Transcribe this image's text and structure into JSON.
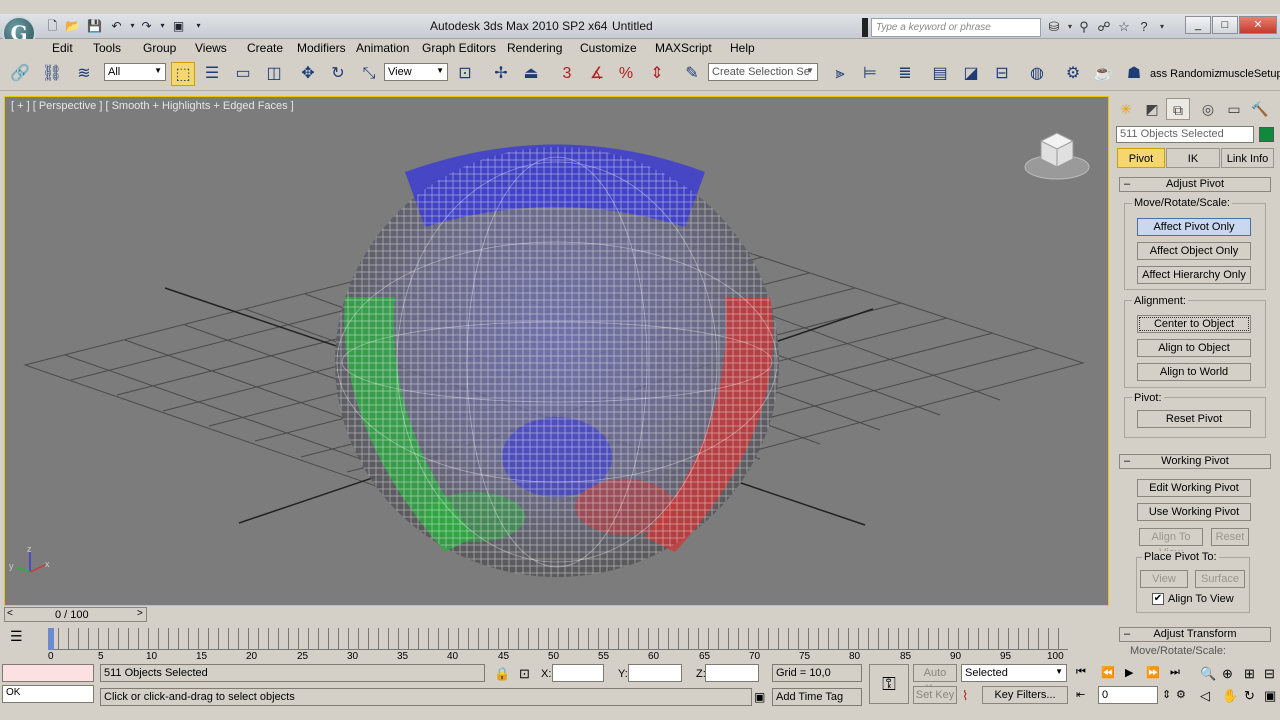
{
  "window": {
    "app_title": "Autodesk 3ds Max  2010 SP2 x64",
    "doc_title": "Untitled",
    "search_placeholder": "Type a keyword or phrase",
    "min_label": "_",
    "max_label": "□",
    "close_label": "✕"
  },
  "menu": [
    "Edit",
    "Tools",
    "Group",
    "Views",
    "Create",
    "Modifiers",
    "Animation",
    "Graph Editors",
    "Rendering",
    "Customize",
    "MAXScript",
    "Help"
  ],
  "toolbar": {
    "filter_value": "All",
    "refcoord_value": "View",
    "selection_set_placeholder": "Create Selection Se",
    "script1_label": "ass Randomiz",
    "script2_label": "muscleSetup"
  },
  "viewport": {
    "label": "[ + ] [ Perspective ] [ Smooth + Highlights + Edged Faces ]",
    "axis_x": "x",
    "axis_y": "y",
    "axis_z": "z"
  },
  "command_panel": {
    "selection_name": "511 Objects Selected",
    "sel_color": "#0f8a3a",
    "tabs": [
      "Pivot",
      "IK",
      "Link Info"
    ],
    "adjust_pivot": {
      "title": "Adjust Pivot",
      "mrs_label": "Move/Rotate/Scale:",
      "affect_pivot_only": "Affect Pivot Only",
      "affect_object_only": "Affect Object Only",
      "affect_hierarchy_only": "Affect Hierarchy Only",
      "alignment_label": "Alignment:",
      "center_to_object": "Center to Object",
      "align_to_object": "Align to Object",
      "align_to_world": "Align to World",
      "pivot_label": "Pivot:",
      "reset_pivot": "Reset Pivot"
    },
    "working_pivot": {
      "title": "Working Pivot",
      "edit_working_pivot": "Edit Working Pivot",
      "use_working_pivot": "Use Working Pivot",
      "align_to_view": "Align To View",
      "reset": "Reset",
      "place_pivot_label": "Place Pivot To:",
      "view": "View",
      "surface": "Surface",
      "align_to_view_check": "Align To View"
    },
    "adjust_transform": {
      "title": "Adjust Transform",
      "partial_label": "Move/Rotate/Scale:"
    }
  },
  "time": {
    "slider_label": "0 / 100",
    "ticks": [
      "0",
      "5",
      "10",
      "15",
      "20",
      "25",
      "30",
      "35",
      "40",
      "45",
      "50",
      "55",
      "60",
      "65",
      "70",
      "75",
      "80",
      "85",
      "90",
      "95",
      "100"
    ]
  },
  "status": {
    "objects_selected": "511 Objects Selected",
    "prompt": "Click or click-and-drag to select objects",
    "ok_label": "OK",
    "x_label": "X:",
    "y_label": "Y:",
    "z_label": "Z:",
    "grid": "Grid = 10,0",
    "add_time_tag": "Add Time Tag",
    "auto_key": "Auto Key",
    "set_key": "Set Key",
    "key_mode_value": "Selected",
    "key_filters": "Key Filters...",
    "frame_value": "0"
  }
}
